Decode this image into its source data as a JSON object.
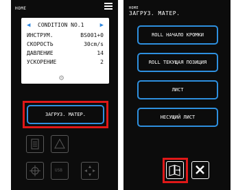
{
  "left": {
    "status": "HOME",
    "condition": "CONDITION NO.1",
    "rows": [
      {
        "key": "ИНСТРУМ.",
        "value": "BS001+0"
      },
      {
        "key": "СКОРОСТЬ",
        "value": "30cm/s"
      },
      {
        "key": "ДАВЛЕНИЕ",
        "value": "14"
      },
      {
        "key": "УСКОРЕНИЕ",
        "value": "2"
      }
    ],
    "load_label": "ЗАГРУЗ. МАТЕР.",
    "usb_label": "USB"
  },
  "right": {
    "status": "HOME",
    "title": "ЗАГРУЗ. МАТЕР.",
    "options": [
      "ROLL НАЧАЛО КРОМКИ",
      "ROLL ТЕКУЩАЯ ПОЗИЦИЯ",
      "ЛИСТ",
      "НЕСУЩИЙ ЛИСТ"
    ]
  },
  "colors": {
    "accent": "#2e90e0",
    "highlight": "#e01818",
    "background": "#0c0c0c"
  }
}
